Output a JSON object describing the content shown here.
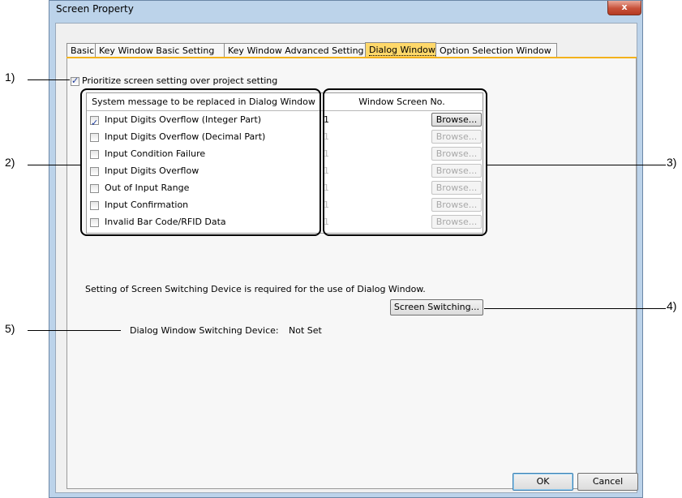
{
  "window": {
    "title": "Screen Property",
    "close_label": "x"
  },
  "tabs": [
    {
      "label": "Basic",
      "active": false
    },
    {
      "label": "Key Window Basic Setting",
      "active": false
    },
    {
      "label": "Key Window Advanced Setting",
      "active": false
    },
    {
      "label": "Dialog Window",
      "active": true
    },
    {
      "label": "Option Selection Window",
      "active": false
    }
  ],
  "prioritize": {
    "label": "Prioritize screen setting over project setting",
    "checked": true
  },
  "table": {
    "header_message": "System message to be replaced in Dialog Window",
    "header_screen": "Window Screen No.",
    "rows": [
      {
        "message": "Input Digits Overflow (Integer Part)",
        "checked": true,
        "screen_no": "1",
        "enabled": true,
        "browse": "Browse..."
      },
      {
        "message": "Input Digits Overflow (Decimal Part)",
        "checked": false,
        "screen_no": "1",
        "enabled": false,
        "browse": "Browse..."
      },
      {
        "message": "Input Condition Failure",
        "checked": false,
        "screen_no": "1",
        "enabled": false,
        "browse": "Browse..."
      },
      {
        "message": "Input Digits Overflow",
        "checked": false,
        "screen_no": "1",
        "enabled": false,
        "browse": "Browse..."
      },
      {
        "message": "Out of Input Range",
        "checked": false,
        "screen_no": "1",
        "enabled": false,
        "browse": "Browse..."
      },
      {
        "message": "Input Confirmation",
        "checked": false,
        "screen_no": "1",
        "enabled": false,
        "browse": "Browse..."
      },
      {
        "message": "Invalid Bar Code/RFID Data",
        "checked": false,
        "screen_no": "1",
        "enabled": false,
        "browse": "Browse..."
      }
    ]
  },
  "note": "Setting of Screen Switching Device is required for the use of Dialog Window.",
  "screen_switching_button": "Screen Switching...",
  "device": {
    "label": "Dialog Window Switching Device:",
    "value": "Not Set"
  },
  "buttons": {
    "ok": "OK",
    "cancel": "Cancel"
  },
  "callouts": [
    "1)",
    "2)",
    "3)",
    "4)",
    "5)"
  ],
  "colors": {
    "active_tab": "#ffd86a",
    "tab_underline": "#f3b21c",
    "window_frame": "#bcd3ea"
  }
}
